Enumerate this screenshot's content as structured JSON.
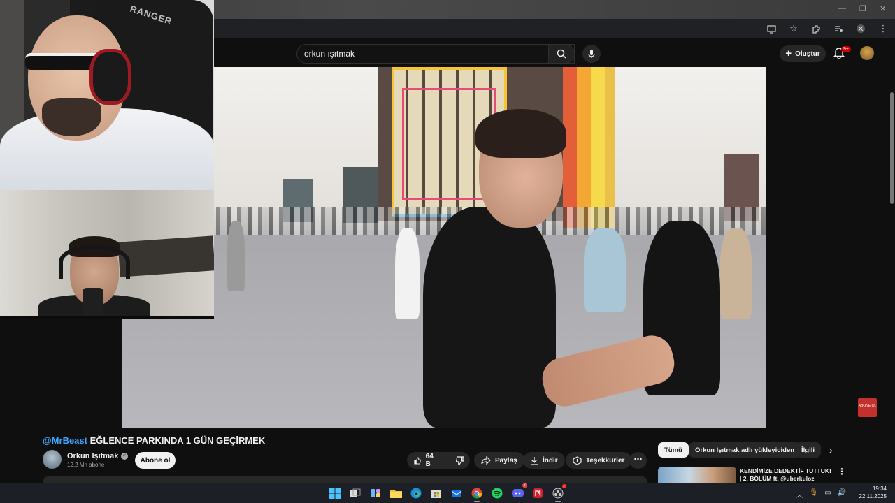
{
  "browser": {
    "window_controls": [
      "—",
      "❐",
      "✕"
    ]
  },
  "youtube": {
    "search": {
      "query": "orkun ışıtmak"
    },
    "header": {
      "create_label": "Oluştur",
      "notifications_badge": "9+"
    },
    "video": {
      "overlay_logo_text": "ABONE OL"
    },
    "watch": {
      "title_mention": "@MrBeast",
      "title_rest": " EĞLENCE PARKINDA 1 GÜN GEÇİRMEK",
      "channel_name": "Orkun Işıtmak",
      "subscribers": "12,2 Mn abone",
      "subscribe_label": "Abone ol",
      "likes": "64 B",
      "share_label": "Paylaş",
      "download_label": "İndir",
      "thanks_label": "Teşekkürler"
    },
    "chips": [
      "Tümü",
      "Orkun Işıtmak adlı yükleyiciden",
      "İlgili"
    ],
    "recommendation": {
      "title": "KENDİMİZE DEDEKTİF TUTTUK! | 2. BÖLÜM ft. @uberkuloz"
    }
  },
  "webcam1": {
    "chair_text": "RANGER"
  },
  "taskbar": {
    "time": "19:34",
    "date": "22.11.2025",
    "discord_badge": "7"
  }
}
